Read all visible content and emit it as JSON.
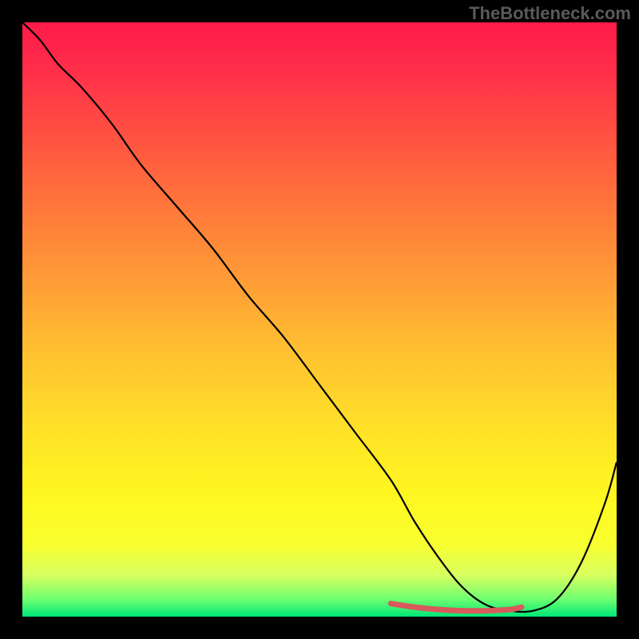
{
  "watermark": "TheBottleneck.com",
  "chart_data": {
    "type": "line",
    "title": "",
    "xlabel": "",
    "ylabel": "",
    "xlim": [
      0,
      100
    ],
    "ylim": [
      0,
      100
    ],
    "background_gradient": {
      "top_color": "#ff1a4a",
      "mid_colors": [
        "#ff7a3a",
        "#ffe028",
        "#f8ff30"
      ],
      "bottom_color": "#00e878",
      "meaning": "red=high bottleneck, green=low bottleneck"
    },
    "series": [
      {
        "name": "bottleneck-curve",
        "color": "#000000",
        "x": [
          0,
          3,
          6,
          10,
          15,
          20,
          26,
          32,
          38,
          44,
          50,
          56,
          62,
          66,
          70,
          74,
          78,
          82,
          86,
          90,
          94,
          98,
          100
        ],
        "y": [
          100,
          97,
          93,
          89,
          83,
          76,
          69,
          62,
          54,
          47,
          39,
          31,
          23,
          16,
          10,
          5,
          2,
          1,
          1,
          3,
          9,
          19,
          26
        ]
      },
      {
        "name": "optimal-range-marker",
        "color": "#e06060",
        "type": "line",
        "stroke_width": 6,
        "x": [
          62,
          66,
          70,
          74,
          78,
          82,
          84
        ],
        "y": [
          2.2,
          1.6,
          1.2,
          1.0,
          1.0,
          1.2,
          1.6
        ]
      }
    ],
    "annotations": []
  }
}
